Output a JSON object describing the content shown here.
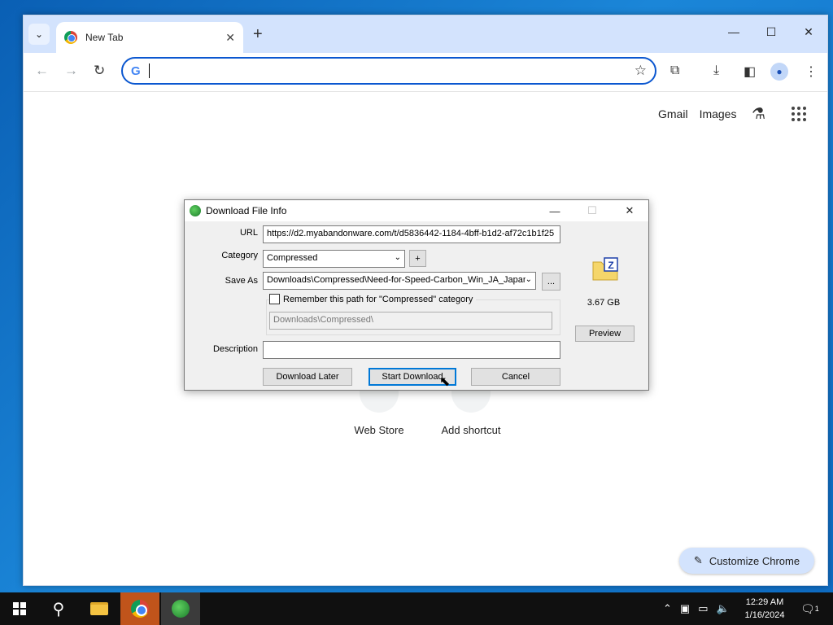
{
  "browser": {
    "tab_title": "New Tab",
    "tab_close": "✕",
    "new_tab": "+",
    "omnibox_value": "",
    "ntp_links": [
      "Gmail",
      "Images"
    ],
    "shortcuts": [
      "Web Store",
      "Add shortcut"
    ],
    "customize_label": "Customize Chrome"
  },
  "dialog": {
    "title": "Download File Info",
    "url_label": "URL",
    "url_value": "https://d2.myabandonware.com/t/d5836442-1184-4bff-b1d2-af72c1b1f25",
    "category_label": "Category",
    "category_value": "Compressed",
    "add_category": "+",
    "save_as_label": "Save As",
    "save_as_value": "Downloads\\Compressed\\Need-for-Speed-Carbon_Win_JA_Japan",
    "browse": "...",
    "remember_label": "Remember this path for \"Compressed\" category",
    "remember_path": "Downloads\\Compressed\\",
    "description_label": "Description",
    "description_value": "",
    "file_size": "3.67 GB",
    "preview": "Preview",
    "download_later": "Download Later",
    "start_download": "Start Download",
    "cancel": "Cancel"
  },
  "taskbar": {
    "time": "12:29 AM",
    "date": "1/16/2024",
    "notification_count": "1"
  }
}
